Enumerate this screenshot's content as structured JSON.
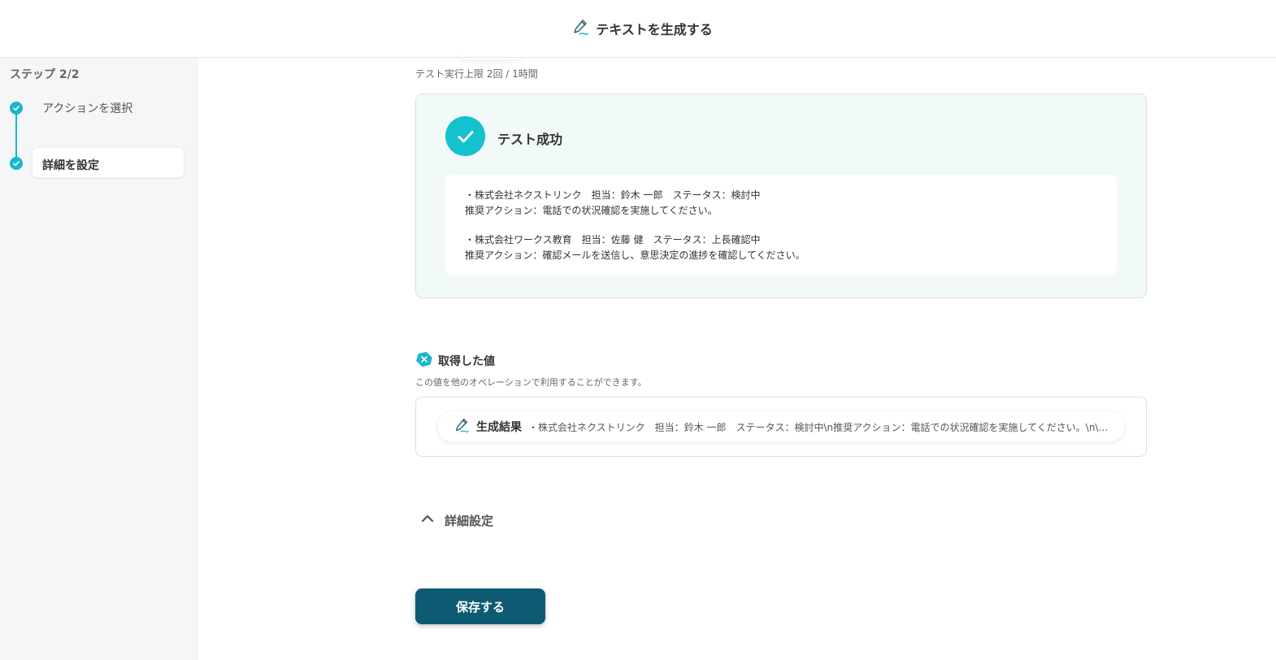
{
  "header": {
    "title": "テキストを生成する",
    "icon": "pen-sparkle-icon"
  },
  "sidebar": {
    "step_label": "ステップ 2/2",
    "items": [
      {
        "label": "アクションを選択",
        "state": "done"
      },
      {
        "label": "詳細を設定",
        "state": "active"
      }
    ]
  },
  "main": {
    "test_limit": "テスト実行上限 2回 / 1時間",
    "test_result": {
      "title": "テスト成功",
      "lines": [
        "・株式会社ネクストリンク　担当：鈴木 一郎　ステータス：検討中",
        "推奨アクション：電話での状況確認を実施してください。",
        "・株式会社ワークス教育　担当：佐藤 健　ステータス：上長確認中",
        "推奨アクション：確認メールを送信し、意思決定の進捗を確認してください。"
      ]
    },
    "values": {
      "title": "取得した値",
      "description": "この値を他のオペレーションで利用することができます。",
      "item": {
        "name": "生成結果",
        "value": "・株式会社ネクストリンク　担当：鈴木 一郎　ステータス：検討中\\n推奨アクション：電話での状況確認を実施してください。\\n\\n・株式..."
      }
    },
    "detail_settings_label": "詳細設定",
    "save_label": "保存する"
  },
  "colors": {
    "accent": "#14c1cf",
    "step": "#19b6cf",
    "primary_button": "#0e5a73",
    "success_bg": "#f1f9f9"
  }
}
